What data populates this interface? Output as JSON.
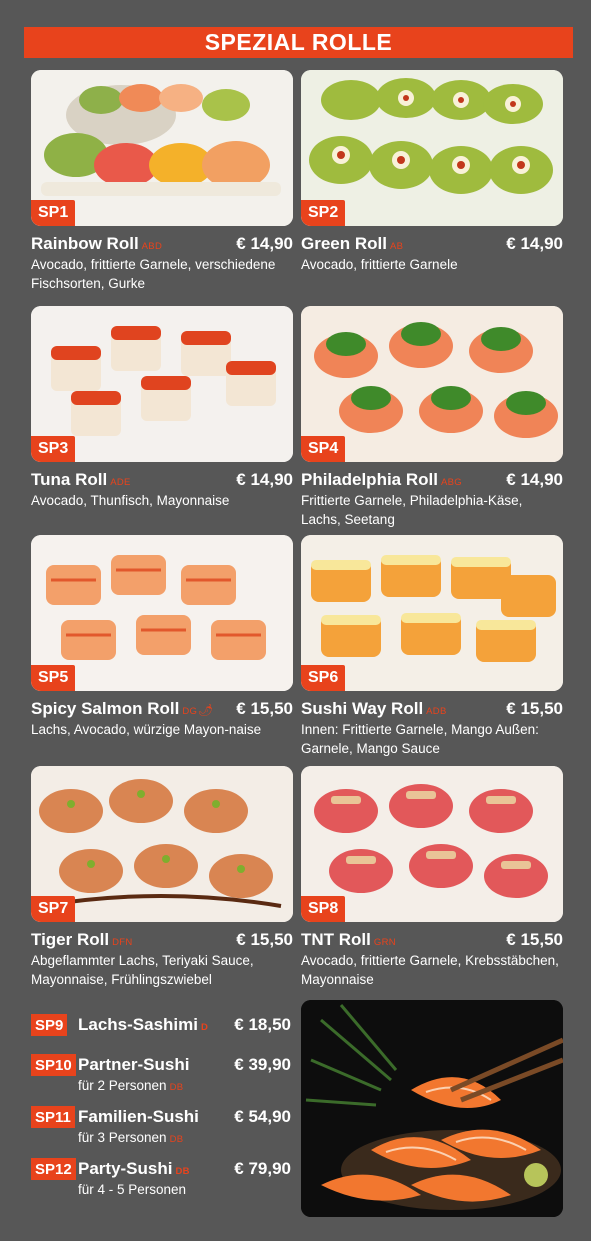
{
  "header": {
    "title": "SPEZIAL ROLLE"
  },
  "colors": {
    "accent": "#e8431c",
    "background": "#575757"
  },
  "items": [
    {
      "code": "SP1",
      "name": "Rainbow Roll",
      "allergens": "ABD",
      "price": "€ 14,90",
      "desc": "Avocado, frittierte Garnele, verschiedene Fischsorten, Gurke",
      "image": "rainbow-roll-photo"
    },
    {
      "code": "SP2",
      "name": "Green Roll",
      "allergens": "AB",
      "price": "€ 14,90",
      "desc": "Avocado, frittierte Garnele",
      "image": "green-roll-photo"
    },
    {
      "code": "SP3",
      "name": "Tuna Roll",
      "allergens": "ADE",
      "price": "€ 14,90",
      "desc": "Avocado, Thunfisch, Mayonnaise",
      "image": "tuna-roll-photo"
    },
    {
      "code": "SP4",
      "name": "Philadelphia Roll",
      "allergens": "ABG",
      "price": "€ 14,90",
      "desc": "Frittierte Garnele, Philadelphia-Käse, Lachs, Seetang",
      "image": "philadelphia-roll-photo"
    },
    {
      "code": "SP5",
      "name": "Spicy Salmon Roll",
      "allergens": "DG",
      "spicy": "chili-icon",
      "price": "€ 15,50",
      "desc": "Lachs, Avocado, würzige Mayon-naise",
      "image": "spicy-salmon-roll-photo"
    },
    {
      "code": "SP6",
      "name": "Sushi Way Roll",
      "allergens": "ADB",
      "price": "€ 15,50",
      "desc": "Innen: Frittierte Garnele, Mango Außen: Garnele, Mango Sauce",
      "image": "sushi-way-roll-photo"
    },
    {
      "code": "SP7",
      "name": "Tiger Roll",
      "allergens": "DFN",
      "price": "€ 15,50",
      "desc": "Abgeflammter Lachs, Teriyaki Sauce, Mayonnaise, Frühlingszwiebel",
      "image": "tiger-roll-photo"
    },
    {
      "code": "SP8",
      "name": "TNT Roll",
      "allergens": "GRN",
      "price": "€ 15,50",
      "desc": "Avocado, frittierte Garnele, Krebsstäbchen, Mayonnaise",
      "image": "tnt-roll-photo"
    }
  ],
  "list": [
    {
      "code": "SP9",
      "name": "Lachs-Sashimi",
      "allergens": "D",
      "price": "€ 18,50",
      "sub": "",
      "sub_allergens": ""
    },
    {
      "code": "SP10",
      "name": "Partner-Sushi",
      "allergens": "",
      "price": "€ 39,90",
      "sub": "für 2 Personen",
      "sub_allergens": "DB"
    },
    {
      "code": "SP11",
      "name": "Familien-Sushi",
      "allergens": "",
      "price": "€ 54,90",
      "sub": "für 3 Personen",
      "sub_allergens": "DB"
    },
    {
      "code": "SP12",
      "name": "Party-Sushi",
      "allergens": "DB",
      "price": "€ 79,90",
      "sub": "für 4 - 5 Personen",
      "sub_allergens": ""
    }
  ],
  "sashimi_image": "salmon-sashimi-photo"
}
